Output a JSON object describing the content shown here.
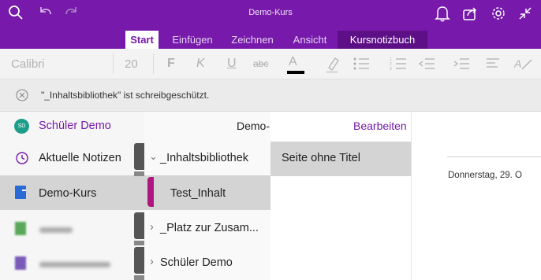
{
  "window": {
    "title": "Demo-Kurs"
  },
  "ribbon": {
    "tabs": [
      {
        "label": "Start",
        "active": true
      },
      {
        "label": "Einfügen"
      },
      {
        "label": "Zeichnen"
      },
      {
        "label": "Ansicht"
      },
      {
        "label": "Kursnotizbuch"
      }
    ]
  },
  "toolbar": {
    "font_name": "Calibri",
    "font_size": "20",
    "bold": "F",
    "italic": "K",
    "underline": "U",
    "strike": "abc",
    "font_color": "A"
  },
  "infobar": {
    "message": "\"_Inhaltsbibliothek\" ist schreibgeschützt."
  },
  "notebooks": {
    "user": {
      "initials": "SD",
      "name": "Schüler Demo"
    },
    "items": [
      {
        "label": "Aktuelle Notizen",
        "icon": "clock-icon"
      },
      {
        "label": "Demo-Kurs",
        "icon": "notebook-icon",
        "selected": true,
        "color": "#2a6ad6"
      },
      {
        "label": "",
        "icon": "notebook-icon",
        "blurred": true,
        "color": "#5aa85a"
      },
      {
        "label": "",
        "icon": "notebook-icon",
        "blurred": true,
        "color": "#7a5ab8"
      }
    ]
  },
  "sections": {
    "header": "Demo-Kurs",
    "edit_label": "Bearbeiten",
    "items": [
      {
        "label": "_Inhaltsbibliothek",
        "chevron": "⌄",
        "expanded": true
      },
      {
        "label": "Test_Inhalt",
        "selected": true,
        "color": "#b0167f"
      },
      {
        "label": "_Platz zur Zusam...",
        "chevron": "›"
      },
      {
        "label": "Schüler Demo",
        "chevron": "›"
      }
    ]
  },
  "pages": {
    "items": [
      {
        "label": "Seite ohne Titel",
        "selected": true
      }
    ]
  },
  "page": {
    "date": "Donnerstag, 29. O"
  },
  "colors": {
    "accent": "#7719aa",
    "accent_dark": "#5d0f86",
    "selection": "#d4d4d4"
  }
}
